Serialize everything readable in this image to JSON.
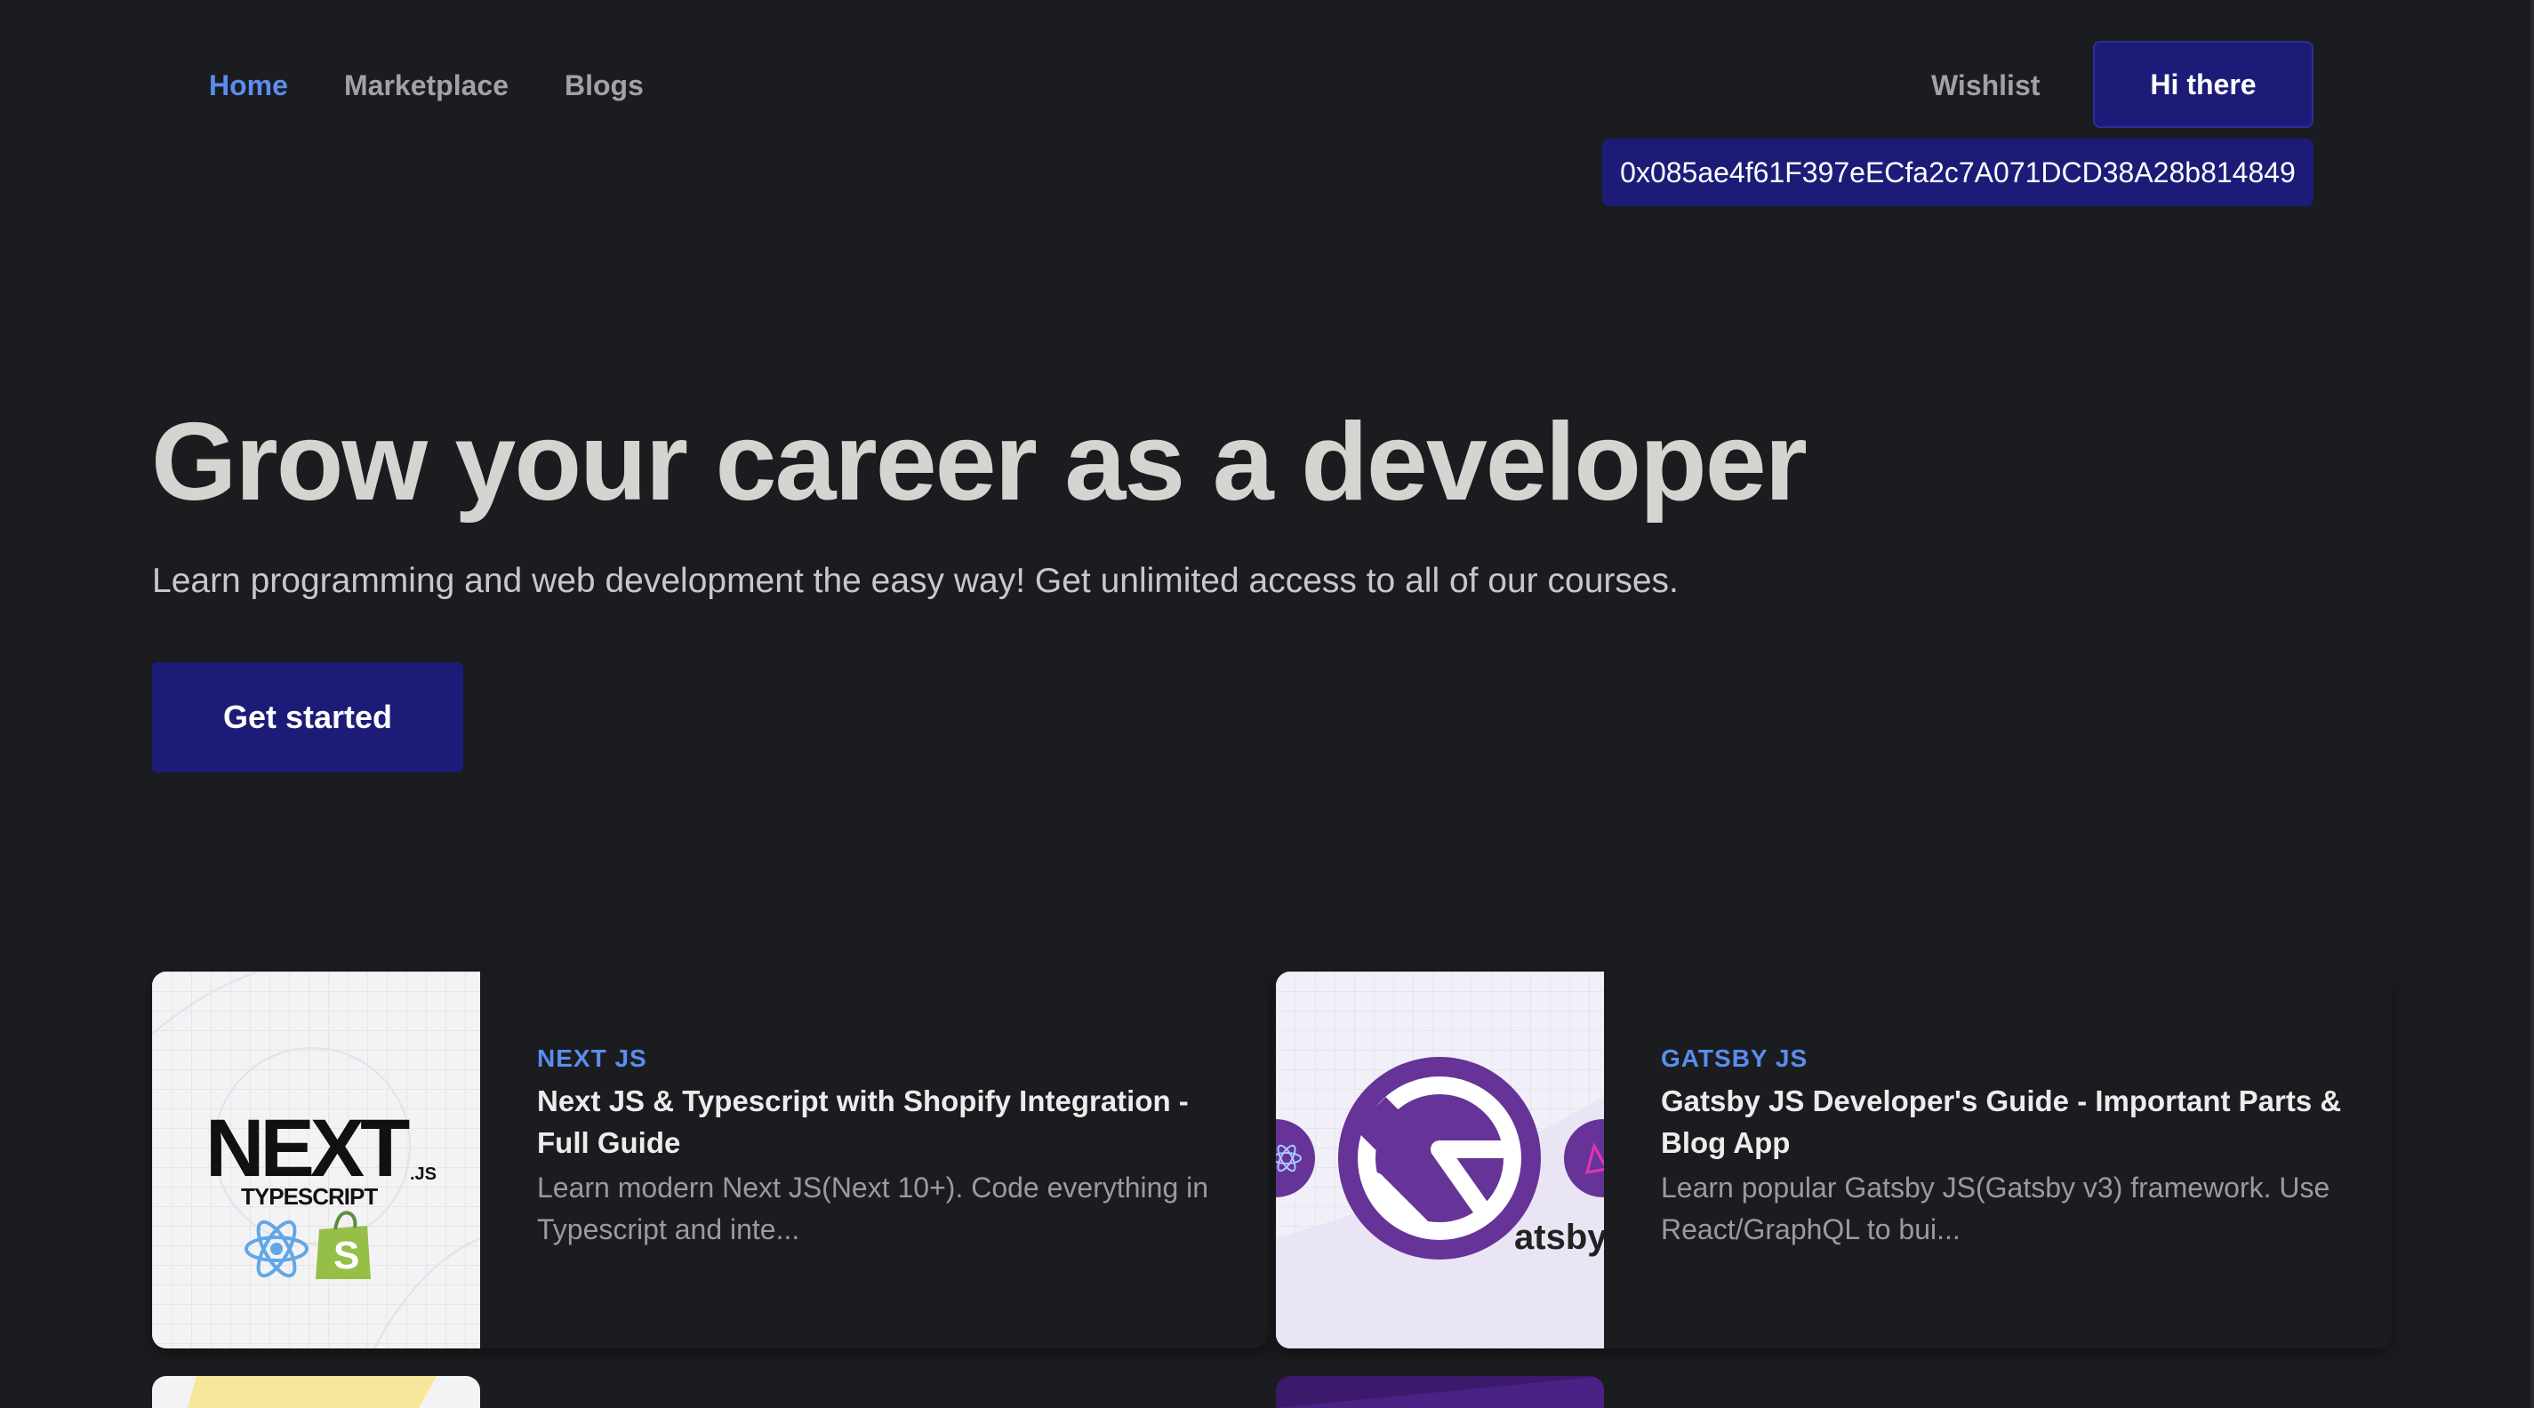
{
  "nav": {
    "links": [
      {
        "label": "Home",
        "active": true
      },
      {
        "label": "Marketplace",
        "active": false
      },
      {
        "label": "Blogs",
        "active": false
      }
    ],
    "wishlist": "Wishlist",
    "greeting_button": "Hi there",
    "wallet_address": "0x085ae4f61F397eECfa2c7A071DCD38A28b814849"
  },
  "hero": {
    "title": "Grow your career as a developer",
    "subtitle": "Learn programming and web development the easy way! Get unlimited access to all of our courses.",
    "cta": "Get started"
  },
  "courses": [
    {
      "category": "NEXT JS",
      "title": "Next JS & Typescript with Shopify Integration - Full Guide",
      "description": "Learn modern Next JS(Next 10+). Code everything in Typescript and inte...",
      "thumb_text": {
        "main": "NEXT",
        "sub": ".JS",
        "tag": "TYPESCRIPT"
      }
    },
    {
      "category": "GATSBY JS",
      "title": "Gatsby JS Developer's Guide - Important Parts & Blog App",
      "description": "Learn popular Gatsby JS(Gatsby v3) framework. Use React/GraphQL to bui...",
      "thumb_text": {
        "wordmark": "atsby"
      }
    }
  ],
  "colors": {
    "background": "#1b1c1f",
    "accent": "#5b8def",
    "button": "#1c1c78",
    "gatsby_purple": "#663399"
  }
}
